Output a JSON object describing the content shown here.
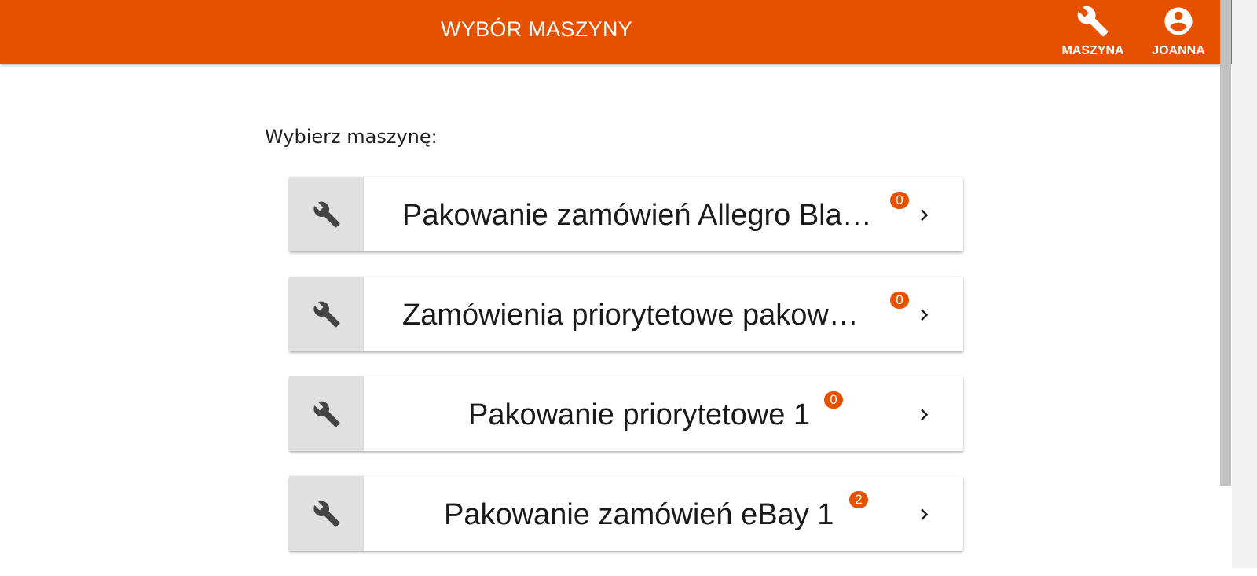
{
  "header": {
    "title": "WYBÓR MASZYNY",
    "nav": [
      {
        "label": "MASZYNA",
        "icon": "wrench-icon"
      },
      {
        "label": "JOANNA",
        "icon": "account-circle-icon"
      }
    ]
  },
  "main": {
    "prompt": "Wybierz maszynę:",
    "machines": [
      {
        "name": "Pakowanie zamówień Allegro Bla…",
        "count": "0",
        "icon": "wrench-icon"
      },
      {
        "name": "Zamówienia priorytetowe pakow…",
        "count": "0",
        "icon": "wrench-icon"
      },
      {
        "name": "Pakowanie priorytetowe 1",
        "count": "0",
        "icon": "wrench-icon"
      },
      {
        "name": "Pakowanie zamówień eBay 1",
        "count": "2",
        "icon": "wrench-icon"
      }
    ]
  },
  "colors": {
    "accent": "#e65100",
    "icon_box": "#e0e0e0",
    "text": "#1a1a1a"
  }
}
